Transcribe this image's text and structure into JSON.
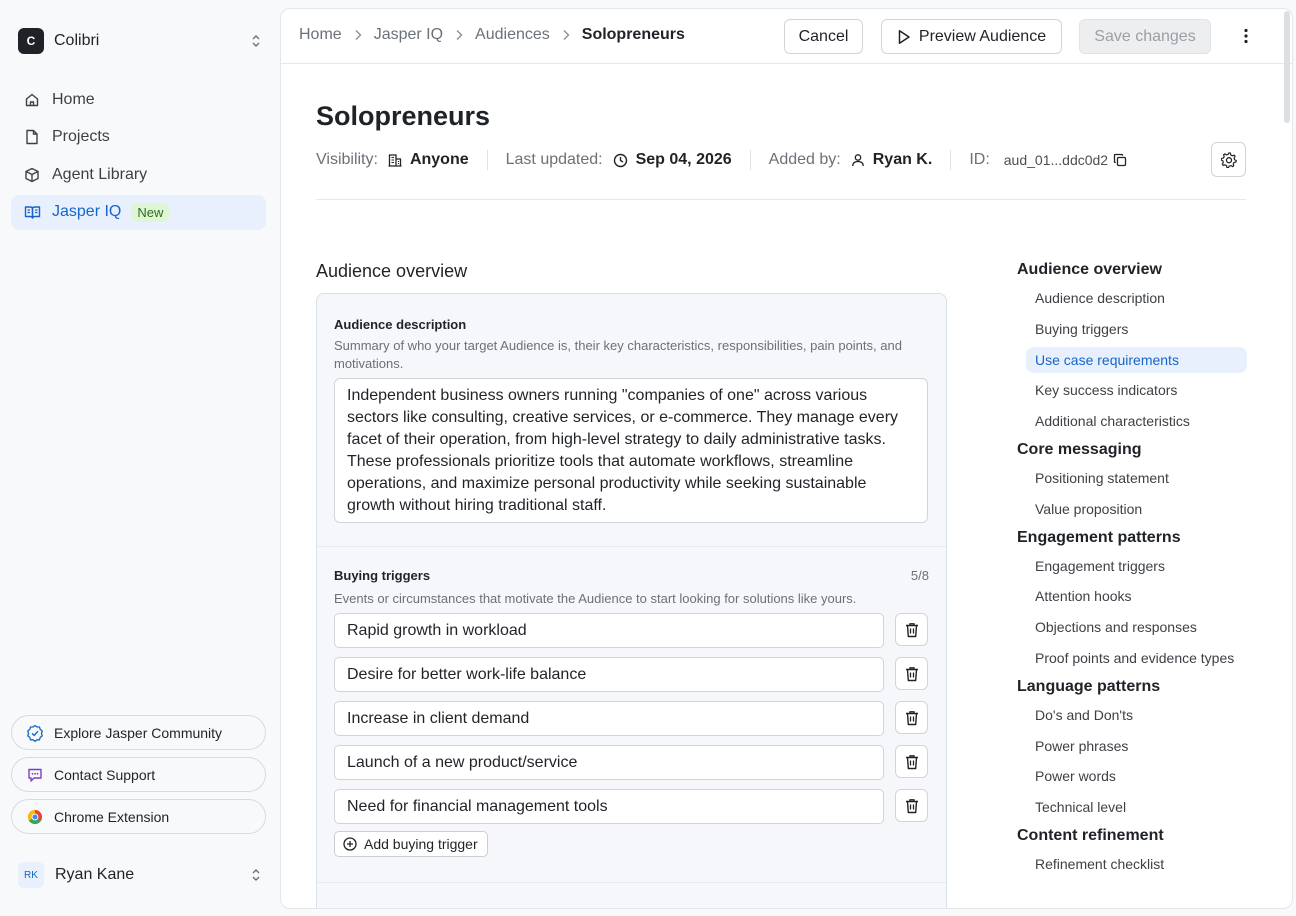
{
  "workspace": {
    "logo_letter": "C",
    "name": "Colibri"
  },
  "nav": [
    {
      "label": "Home",
      "icon": "home-icon"
    },
    {
      "label": "Projects",
      "icon": "file-icon"
    },
    {
      "label": "Agent Library",
      "icon": "cube-icon"
    },
    {
      "label": "Jasper IQ",
      "icon": "book-icon",
      "badge": "New",
      "active": true
    }
  ],
  "footer_links": [
    "Explore Jasper Community",
    "Contact Support",
    "Chrome Extension"
  ],
  "user": {
    "initials": "RK",
    "name": "Ryan Kane"
  },
  "breadcrumb": [
    "Home",
    "Jasper IQ",
    "Audiences",
    "Solopreneurs"
  ],
  "toolbar": {
    "cancel": "Cancel",
    "preview": "Preview Audience",
    "save": "Save changes"
  },
  "page": {
    "title": "Solopreneurs",
    "visibility_label": "Visibility:",
    "visibility_value": "Anyone",
    "updated_label": "Last updated:",
    "updated_value": "Sep 04, 2026",
    "added_label": "Added by:",
    "added_value": "Ryan K.",
    "id_label": "ID:",
    "id_value": "aud_01...ddc0d2"
  },
  "section_title": "Audience overview",
  "description": {
    "label": "Audience description",
    "help": "Summary of who your target Audience is, their key characteristics, responsibilities, pain points, and motivations.",
    "value": "Independent business owners running \"companies of one\" across various sectors like consulting, creative services, or e-commerce. They manage every facet of their operation, from high-level strategy to daily administrative tasks. These professionals prioritize tools that automate workflows, streamline operations, and maximize personal productivity while seeking sustainable growth without hiring traditional staff."
  },
  "buying_triggers": {
    "label": "Buying triggers",
    "count": "5/8",
    "help": "Events or circumstances that motivate the Audience to start looking for solutions like yours.",
    "items": [
      "Rapid growth in workload",
      "Desire for better work-life balance",
      "Increase in client demand",
      "Launch of a new product/service",
      "Need for financial management tools"
    ],
    "add_label": "Add buying trigger"
  },
  "toc": [
    {
      "heading": "Audience overview",
      "items": [
        "Audience description",
        "Buying triggers",
        "Use case requirements",
        "Key success indicators",
        "Additional characteristics"
      ],
      "active": "Use case requirements"
    },
    {
      "heading": "Core messaging",
      "items": [
        "Positioning statement",
        "Value proposition"
      ]
    },
    {
      "heading": "Engagement patterns",
      "items": [
        "Engagement triggers",
        "Attention hooks",
        "Objections and responses",
        "Proof points and evidence types"
      ]
    },
    {
      "heading": "Language patterns",
      "items": [
        "Do's and Don'ts",
        "Power phrases",
        "Power words",
        "Technical level"
      ]
    },
    {
      "heading": "Content refinement",
      "items": [
        "Refinement checklist"
      ]
    }
  ],
  "colors": {
    "accent": "#1765c9",
    "active_bg": "#e7f0fc",
    "badge_bg": "#dff5d3"
  }
}
